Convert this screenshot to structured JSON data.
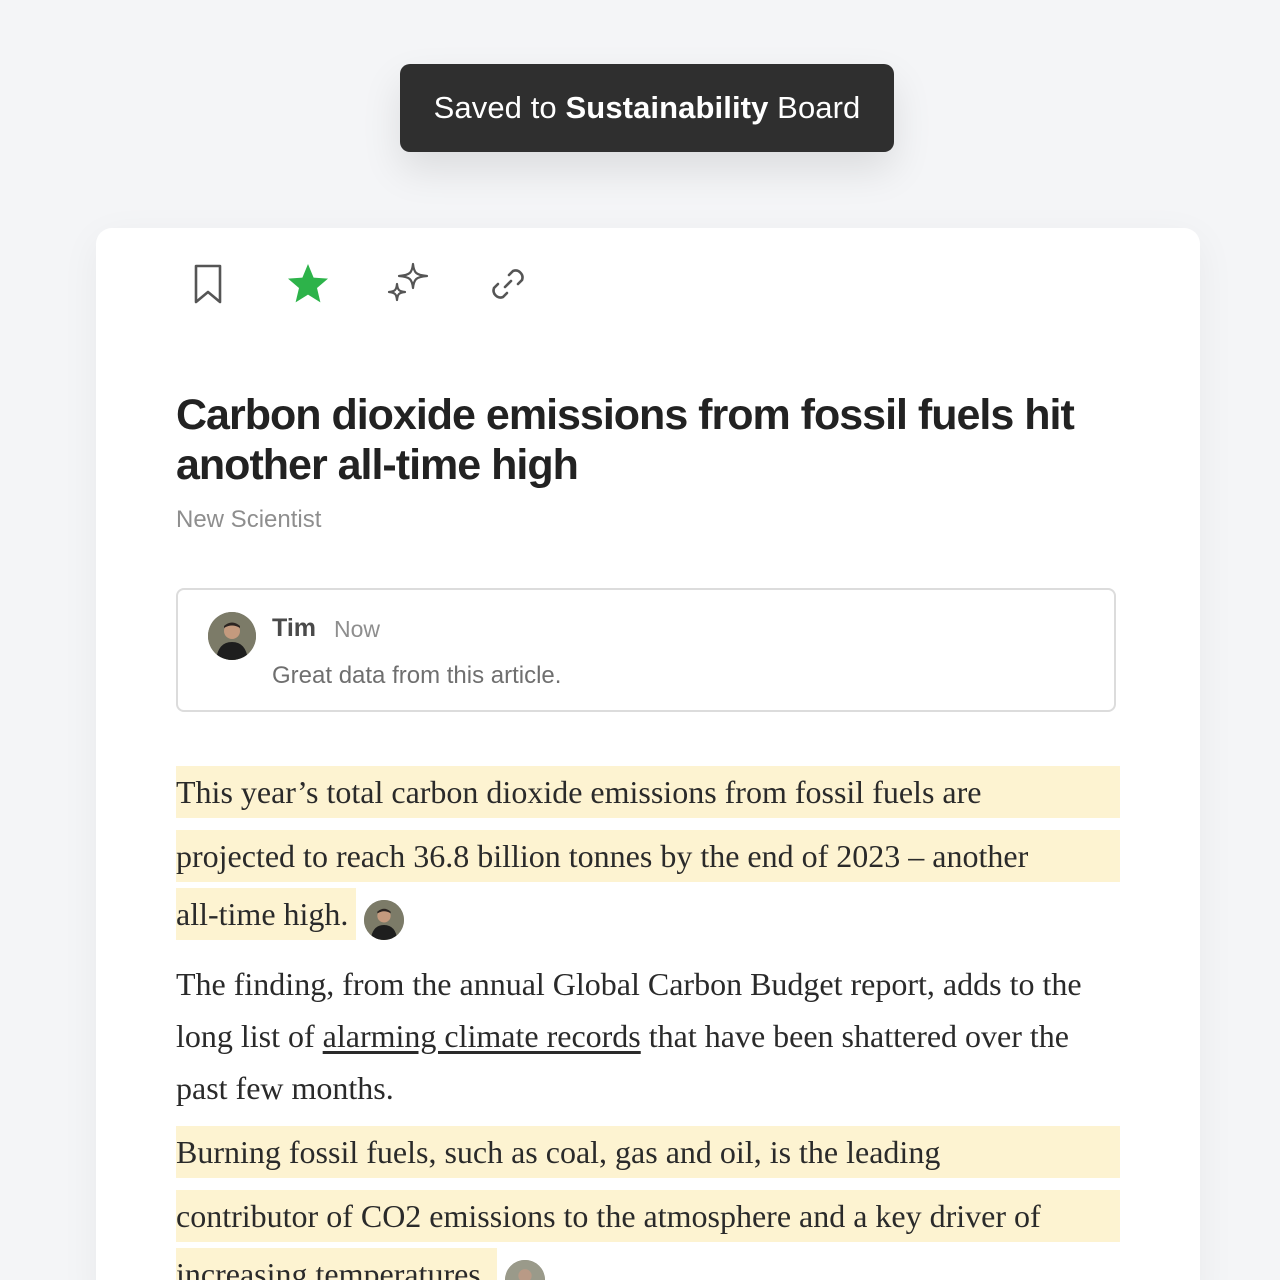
{
  "toast": {
    "prefix": "Saved to ",
    "board_name": "Sustainability",
    "suffix": " Board"
  },
  "toolbar": {
    "icons": [
      "bookmark-icon",
      "star-icon",
      "sparkles-icon",
      "link-icon"
    ],
    "star_color": "#2db34a"
  },
  "article": {
    "title": "Carbon dioxide emissions from fossil fuels hit another all-time high",
    "source": "New Scientist",
    "paragraph1_lines": [
      "This year’s total carbon dioxide emissions from fossil fuels are",
      "projected to reach 36.8 billion tonnes by the end of 2023 – another",
      "all-time high."
    ],
    "paragraph2": {
      "before": "The finding, from the annual Global Carbon Budget report, adds to the long list of ",
      "link": "alarming climate records",
      "after": " that have been shattered over the past few months."
    },
    "paragraph3_lines": [
      "Burning fossil fuels, such as coal, gas and oil, is the leading",
      "contributor of CO2 emissions to the atmosphere and a key driver of",
      "increasing temperatures."
    ]
  },
  "comment": {
    "author": "Tim",
    "time": "Now",
    "text": "Great data from this article."
  },
  "colors": {
    "highlight": "#fdf3d1",
    "toast_bg": "#2f2f2f"
  }
}
